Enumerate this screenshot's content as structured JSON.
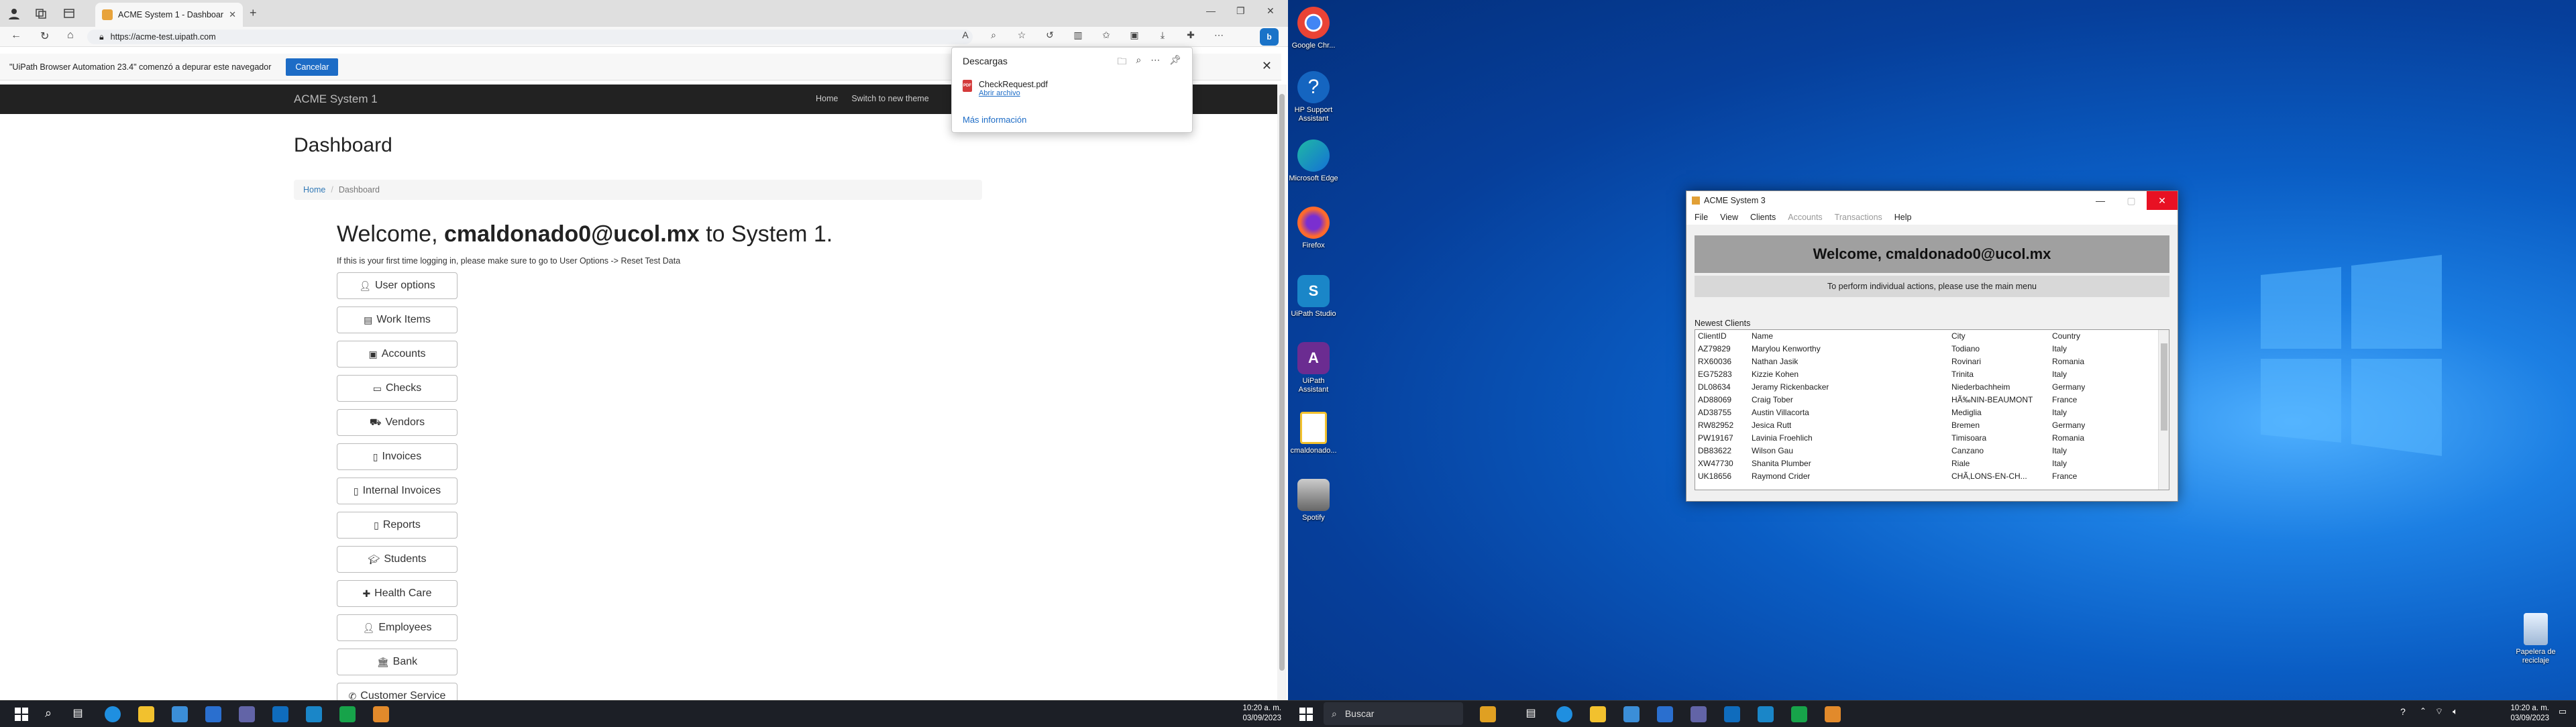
{
  "browser": {
    "tab_title": "ACME System 1 - Dashboard",
    "url": "https://acme-test.uipath.com",
    "infobar_text": "\"UiPath Browser Automation 23.4\" comenzó a depurar este navegador",
    "infobar_button": "Cancelar"
  },
  "downloads": {
    "title": "Descargas",
    "file_name": "CheckRequest.pdf",
    "open_link": "Abrir archivo",
    "more_info": "Más información"
  },
  "site": {
    "brand": "ACME System 1",
    "nav": [
      "Home",
      "Switch to new theme"
    ],
    "page_title": "Dashboard",
    "breadcrumb": [
      "Home",
      "Dashboard"
    ],
    "welcome_prefix": "Welcome, ",
    "user": "cmaldonado0@ucol.mx",
    "welcome_suffix": " to System 1.",
    "hint": "If this is your first time logging in, please make sure to go to User Options -> Reset Test Data",
    "menu": [
      {
        "label": "User options",
        "icon": "user-icon"
      },
      {
        "label": "Work Items",
        "icon": "folder-icon"
      },
      {
        "label": "Accounts",
        "icon": "money-icon"
      },
      {
        "label": "Checks",
        "icon": "card-icon"
      },
      {
        "label": "Vendors",
        "icon": "truck-icon"
      },
      {
        "label": "Invoices",
        "icon": "file-icon"
      },
      {
        "label": "Internal Invoices",
        "icon": "file-icon"
      },
      {
        "label": "Reports",
        "icon": "file-outline-icon"
      },
      {
        "label": "Students",
        "icon": "graduation-icon"
      },
      {
        "label": "Health Care",
        "icon": "medkit-icon"
      },
      {
        "label": "Employees",
        "icon": "user-icon"
      },
      {
        "label": "Bank",
        "icon": "bank-icon"
      },
      {
        "label": "Customer Service",
        "icon": "phone-icon"
      }
    ]
  },
  "taskbar": {
    "time": "10:20 a. m.",
    "date": "03/09/2023",
    "search_placeholder": "Buscar"
  },
  "desktop": {
    "icons": [
      "Google Chr...",
      "HP Support Assistant",
      "Microsoft Edge",
      "Firefox",
      "UiPath Studio",
      "UiPath Assistant",
      "cmaldonado...",
      "Spotify"
    ],
    "recycle_bin": "Papelera de reciclaje"
  },
  "acme3": {
    "title": "ACME System 3",
    "menu": [
      "File",
      "View",
      "Clients",
      "Accounts",
      "Transactions",
      "Help"
    ],
    "disabled_menu": [
      "Accounts",
      "Transactions"
    ],
    "banner": "Welcome, cmaldonado0@ucol.mx",
    "subtext": "To perform individual actions, please use the main menu",
    "grid_label": "Newest Clients",
    "columns": [
      "ClientID",
      "Name",
      "City",
      "Country"
    ],
    "rows": [
      [
        "AZ79829",
        "Marylou Kenworthy",
        "Todiano",
        "Italy"
      ],
      [
        "RX60036",
        "Nathan Jasik",
        "Rovinari",
        "Romania"
      ],
      [
        "EG75283",
        "Kizzie Kohen",
        "Trinita",
        "Italy"
      ],
      [
        "DL08634",
        "Jeramy Rickenbacker",
        "Niederbachheim",
        "Germany"
      ],
      [
        "AD88069",
        "Craig Tober",
        "HÃ‰NIN-BEAUMONT",
        "France"
      ],
      [
        "AD38755",
        "Austin Villacorta",
        "Mediglia",
        "Italy"
      ],
      [
        "RW82952",
        "Jesica Rutt",
        "Bremen",
        "Germany"
      ],
      [
        "PW19167",
        "Lavinia Froehlich",
        "Timisoara",
        "Romania"
      ],
      [
        "DB83622",
        "Wilson Gau",
        "Canzano",
        "Italy"
      ],
      [
        "XW47730",
        "Shanita Plumber",
        "Riale",
        "Italy"
      ],
      [
        "UK18656",
        "Raymond Crider",
        "CHÃ‚LONS-EN-CH...",
        "France"
      ]
    ]
  }
}
